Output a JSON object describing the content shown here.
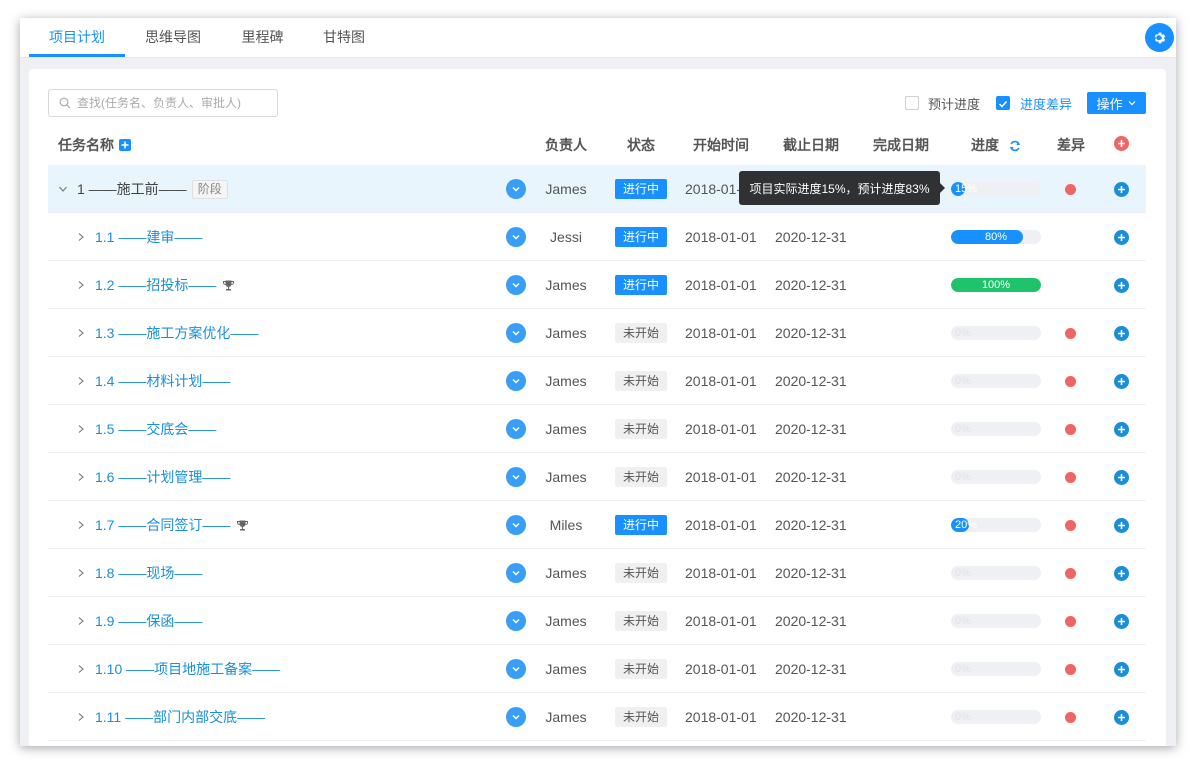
{
  "tabs": [
    {
      "label": "项目计划",
      "active": true
    },
    {
      "label": "思维导图",
      "active": false
    },
    {
      "label": "里程碑",
      "active": false
    },
    {
      "label": "甘特图",
      "active": false
    }
  ],
  "toolbar": {
    "search_placeholder": "查找(任务名、负责人、审批人)",
    "planned_progress_label": "预计进度",
    "planned_progress_checked": false,
    "progress_diff_label": "进度差异",
    "progress_diff_checked": true,
    "operation_label": "操作"
  },
  "columns": {
    "task_name": "任务名称",
    "owner": "负责人",
    "status": "状态",
    "start": "开始时间",
    "deadline": "截止日期",
    "finish": "完成日期",
    "progress": "进度",
    "diff": "差异"
  },
  "tooltip": "项目实际进度15%，预计进度83%",
  "colors": {
    "accent": "#1890ff",
    "complete": "#1ec36b",
    "diff_dot": "#ef6565",
    "highlight_row": "#e8f5fd"
  },
  "rows": [
    {
      "name": "1 ——施工前——",
      "tag": "阶段",
      "trophy": false,
      "root": true,
      "owner": "James",
      "status": "进行中",
      "running": true,
      "start": "2018-01-",
      "deadline": "",
      "finish": "",
      "progress": 0.15,
      "progress_label": "15%",
      "diff": true
    },
    {
      "name": "1.1 ——建审——",
      "tag": "",
      "trophy": false,
      "root": false,
      "owner": "Jessi",
      "status": "进行中",
      "running": true,
      "start": "2018-01-01",
      "deadline": "2020-12-31",
      "finish": "",
      "progress": 0.8,
      "progress_label": "80%",
      "diff": false
    },
    {
      "name": "1.2 ——招投标——",
      "tag": "",
      "trophy": true,
      "root": false,
      "owner": "James",
      "status": "进行中",
      "running": true,
      "start": "2018-01-01",
      "deadline": "2020-12-31",
      "finish": "",
      "progress": 1.0,
      "progress_label": "100%",
      "diff": false
    },
    {
      "name": "1.3 ——施工方案优化——",
      "tag": "",
      "trophy": false,
      "root": false,
      "owner": "James",
      "status": "未开始",
      "running": false,
      "start": "2018-01-01",
      "deadline": "2020-12-31",
      "finish": "",
      "progress": 0,
      "progress_label": "0%",
      "diff": true
    },
    {
      "name": "1.4 ——材料计划——",
      "tag": "",
      "trophy": false,
      "root": false,
      "owner": "James",
      "status": "未开始",
      "running": false,
      "start": "2018-01-01",
      "deadline": "2020-12-31",
      "finish": "",
      "progress": 0,
      "progress_label": "0%",
      "diff": true
    },
    {
      "name": "1.5 ——交底会——",
      "tag": "",
      "trophy": false,
      "root": false,
      "owner": "James",
      "status": "未开始",
      "running": false,
      "start": "2018-01-01",
      "deadline": "2020-12-31",
      "finish": "",
      "progress": 0,
      "progress_label": "0%",
      "diff": true
    },
    {
      "name": "1.6 ——计划管理——",
      "tag": "",
      "trophy": false,
      "root": false,
      "owner": "James",
      "status": "未开始",
      "running": false,
      "start": "2018-01-01",
      "deadline": "2020-12-31",
      "finish": "",
      "progress": 0,
      "progress_label": "0%",
      "diff": true
    },
    {
      "name": "1.7 ——合同签订——",
      "tag": "",
      "trophy": true,
      "root": false,
      "owner": "Miles",
      "status": "进行中",
      "running": true,
      "start": "2018-01-01",
      "deadline": "2020-12-31",
      "finish": "",
      "progress": 0.2,
      "progress_label": "20%",
      "diff": true
    },
    {
      "name": "1.8 ——现场——",
      "tag": "",
      "trophy": false,
      "root": false,
      "owner": "James",
      "status": "未开始",
      "running": false,
      "start": "2018-01-01",
      "deadline": "2020-12-31",
      "finish": "",
      "progress": 0,
      "progress_label": "0%",
      "diff": true
    },
    {
      "name": "1.9 ——保函——",
      "tag": "",
      "trophy": false,
      "root": false,
      "owner": "James",
      "status": "未开始",
      "running": false,
      "start": "2018-01-01",
      "deadline": "2020-12-31",
      "finish": "",
      "progress": 0,
      "progress_label": "0%",
      "diff": true
    },
    {
      "name": "1.10 ——项目地施工备案——",
      "tag": "",
      "trophy": false,
      "root": false,
      "owner": "James",
      "status": "未开始",
      "running": false,
      "start": "2018-01-01",
      "deadline": "2020-12-31",
      "finish": "",
      "progress": 0,
      "progress_label": "0%",
      "diff": true
    },
    {
      "name": "1.11 ——部门内部交底——",
      "tag": "",
      "trophy": false,
      "root": false,
      "owner": "James",
      "status": "未开始",
      "running": false,
      "start": "2018-01-01",
      "deadline": "2020-12-31",
      "finish": "",
      "progress": 0,
      "progress_label": "0%",
      "diff": true
    }
  ]
}
